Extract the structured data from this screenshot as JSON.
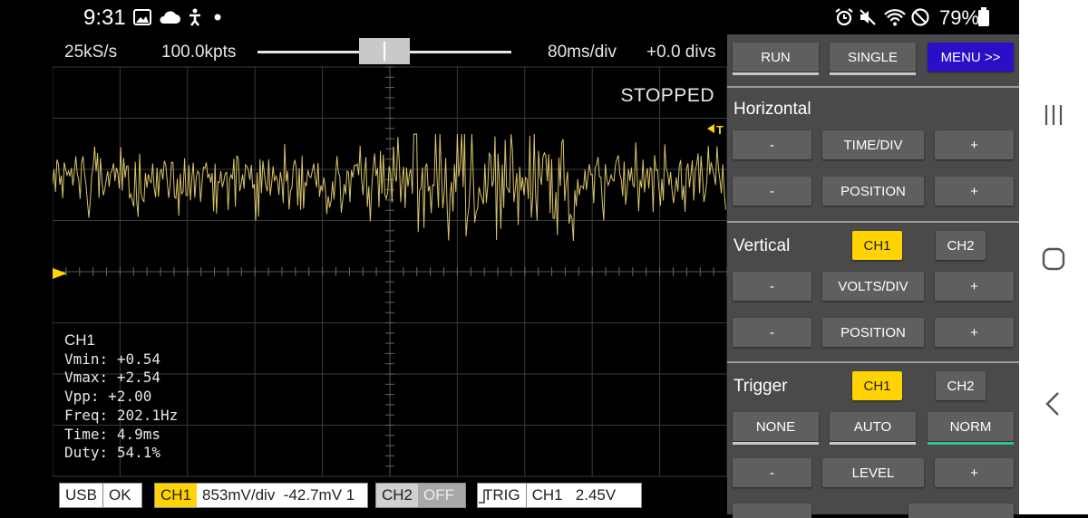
{
  "status_bar": {
    "time": "9:31",
    "battery": "79%",
    "icons": [
      "gallery-icon",
      "cloud-icon",
      "accessibility-icon",
      "notification-dot-icon",
      "alarm-icon",
      "mute-icon",
      "wifi-icon",
      "dnd-icon",
      "battery-icon"
    ]
  },
  "scope": {
    "sample_rate": "25kS/s",
    "points": "100.0kpts",
    "time_div": "80ms/div",
    "offset": "+0.0 divs",
    "state": "STOPPED",
    "trigger_marker": "T",
    "trace_color": "#d9c46a",
    "measurements": {
      "channel": "CH1",
      "vmin_label": "Vmin:",
      "vmin": "+0.54",
      "vmax_label": "Vmax:",
      "vmax": "+2.54",
      "vpp_label": "Vpp:",
      "vpp": "+2.00",
      "freq_label": "Freq:",
      "freq": "202.1Hz",
      "time_label": "Time:",
      "time": "4.9ms",
      "duty_label": "Duty:",
      "duty": "54.1%"
    },
    "status_boxes": {
      "usb_tag": "USB",
      "usb_value": "OK",
      "ch1_tag": "CH1",
      "ch1_value": "853mV/div  -42.7mV 1",
      "ch2_tag": "CH2",
      "ch2_value": "OFF",
      "trig_tag": "TRIG",
      "trig_value": "CH1   2.45V"
    }
  },
  "panel": {
    "run": "RUN",
    "single": "SINGLE",
    "menu": "MENU >>",
    "horizontal_title": "Horizontal",
    "time_div": "TIME/DIV",
    "position": "POSITION",
    "vertical_title": "Vertical",
    "ch1": "CH1",
    "ch2": "CH2",
    "volts_div": "VOLTS/DIV",
    "trigger_title": "Trigger",
    "none": "NONE",
    "auto": "AUTO",
    "norm": "NORM",
    "level": "LEVEL",
    "minus": "-",
    "plus": "+",
    "accent_yellow": "#ffd400",
    "accent_purple": "#2a0fc8",
    "accent_green": "#2ec48a"
  },
  "nav": [
    "recents-icon",
    "home-icon",
    "back-icon"
  ]
}
